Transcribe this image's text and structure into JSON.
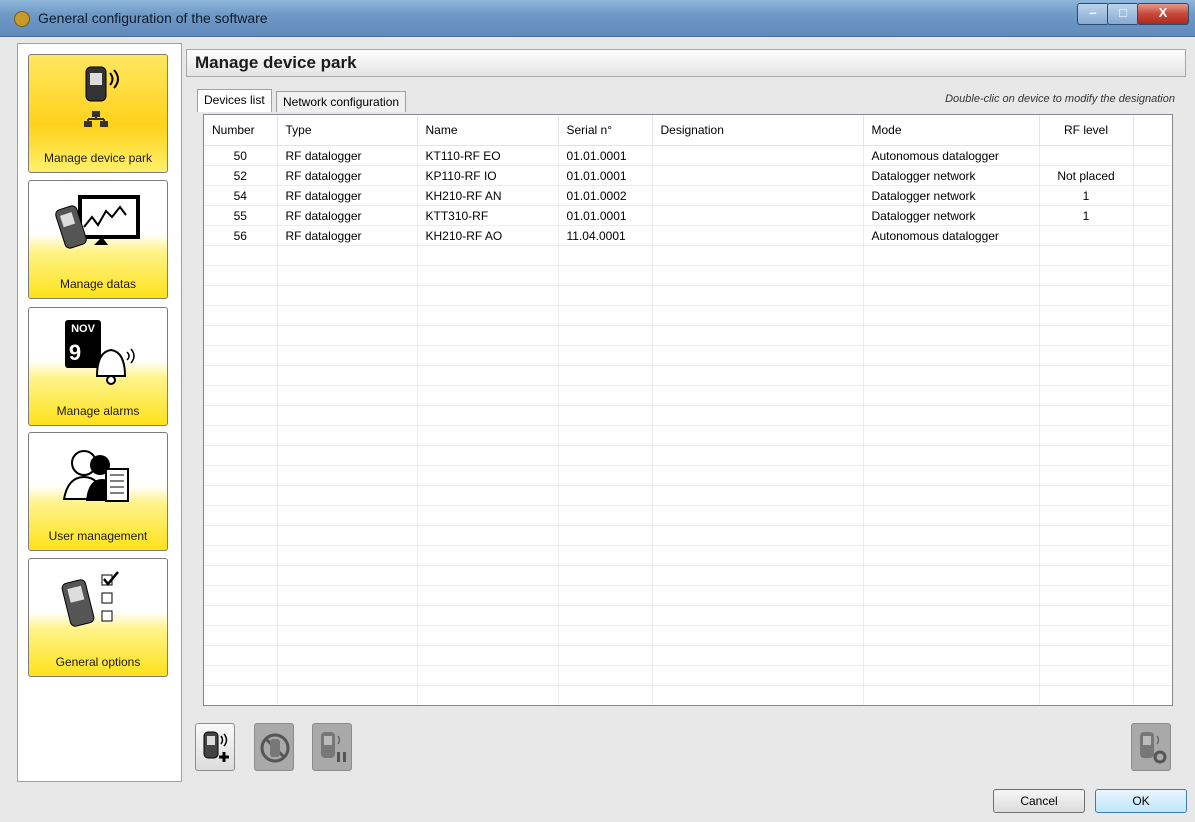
{
  "window": {
    "title": "General configuration of the software"
  },
  "sidebar": {
    "items": [
      {
        "label": "Manage device park",
        "icon": "device-network-icon",
        "active": true
      },
      {
        "label": "Manage datas",
        "icon": "datas-chart-icon",
        "active": false
      },
      {
        "label": "Manage alarms",
        "icon": "alarm-bell-icon",
        "active": false,
        "calendar_month": "NOV",
        "calendar_day": "9"
      },
      {
        "label": "User management",
        "icon": "users-icon",
        "active": false
      },
      {
        "label": "General options",
        "icon": "options-checklist-icon",
        "active": false
      }
    ]
  },
  "main": {
    "title": "Manage device park",
    "tabs": [
      {
        "label": "Devices list",
        "selected": true
      },
      {
        "label": "Network configuration",
        "selected": false
      }
    ],
    "hint": "Double-clic on device to modify the designation",
    "table": {
      "columns": [
        "Number",
        "Type",
        "Name",
        "Serial n°",
        "Designation",
        "Mode",
        "RF level"
      ],
      "rows": [
        [
          "50",
          "RF datalogger",
          "KT110-RF EO",
          "01.01.0001",
          "",
          "Autonomous datalogger",
          ""
        ],
        [
          "52",
          "RF datalogger",
          "KP110-RF IO",
          "01.01.0001",
          "",
          "Datalogger network",
          "Not placed"
        ],
        [
          "54",
          "RF datalogger",
          "KH210-RF AN",
          "01.01.0002",
          "",
          "Datalogger network",
          "1"
        ],
        [
          "55",
          "RF datalogger",
          "KTT310-RF",
          "01.01.0001",
          "",
          "Datalogger network",
          "1"
        ],
        [
          "56",
          "RF datalogger",
          "KH210-RF AO",
          "11.04.0001",
          "",
          "Autonomous datalogger",
          ""
        ]
      ]
    },
    "toolbar": [
      {
        "name": "add-device-button",
        "icon": "add-device-icon",
        "enabled": true
      },
      {
        "name": "remove-device-button",
        "icon": "remove-device-icon",
        "enabled": false
      },
      {
        "name": "pause-device-button",
        "icon": "pause-device-icon",
        "enabled": false
      },
      {
        "name": "device-settings-button",
        "icon": "device-settings-icon",
        "enabled": false
      }
    ]
  },
  "footer": {
    "cancel_label": "Cancel",
    "ok_label": "OK"
  }
}
